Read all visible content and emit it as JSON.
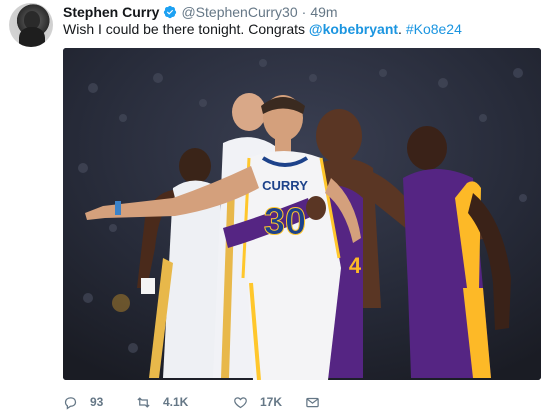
{
  "tweet": {
    "display_name": "Stephen Curry",
    "handle": "@StephenCurry30",
    "separator": "·",
    "time": "49m",
    "text_before": "Wish I could be there tonight. Congrats ",
    "mention": "@kobebryant",
    "text_middle": ". ",
    "hashtag": "#Ko8e24"
  },
  "photo": {
    "jersey_name": "CURRY",
    "jersey_number": "30",
    "opponent_number_partial": "4"
  },
  "actions": {
    "reply_count": "93",
    "retweet_count": "4.1K",
    "like_count": "17K"
  },
  "colors": {
    "link": "#1b95e0",
    "muted": "#657786",
    "warriors_white": "#f4f4f6",
    "warriors_blue": "#1d428a",
    "warriors_gold": "#ffc72c",
    "lakers_purple": "#552583",
    "lakers_gold": "#fdb927"
  }
}
